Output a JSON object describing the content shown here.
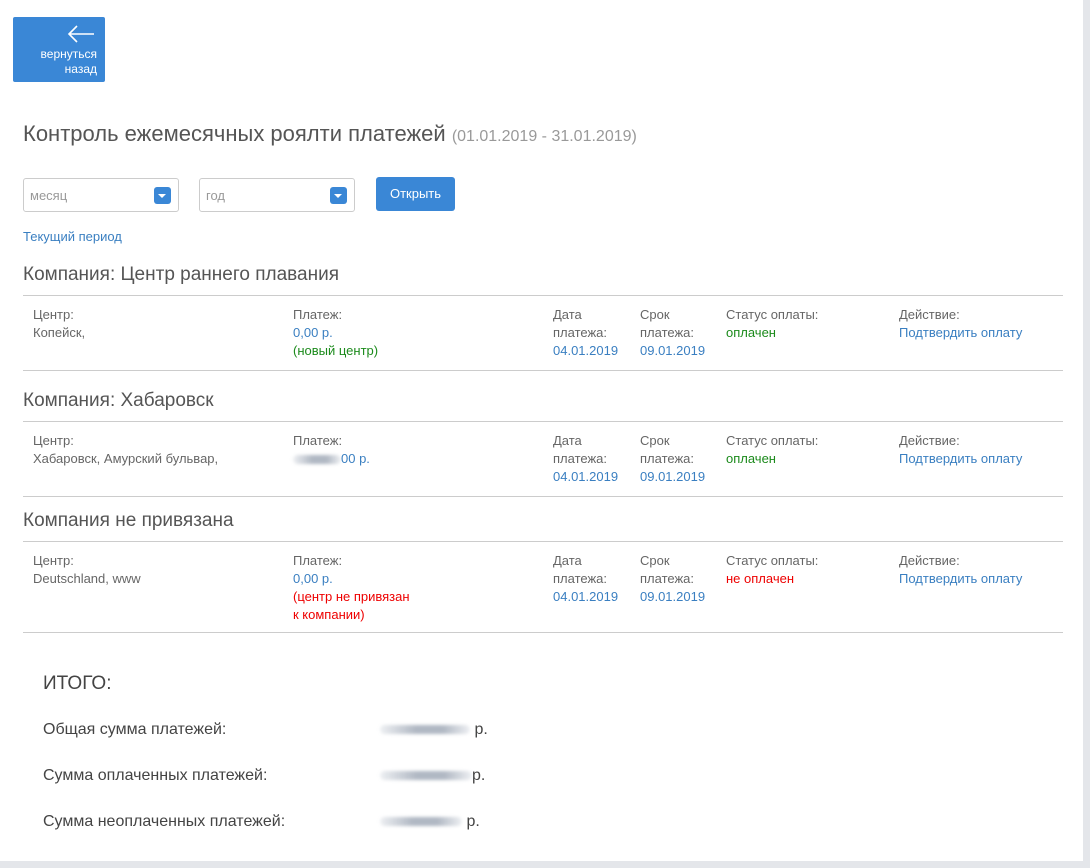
{
  "header": {
    "back_label_line1": "вернуться",
    "back_label_line2": "назад",
    "title": "Контроль ежемесячных роялти платежей",
    "period": "(01.01.2019 - 31.01.2019)"
  },
  "filters": {
    "month_placeholder": "месяц",
    "year_placeholder": "год",
    "open_label": "Открыть",
    "current_period_label": "Текущий период"
  },
  "labels": {
    "center": "Центр:",
    "payment": "Платеж:",
    "date_line1": "Дата",
    "date_line2": "платежа:",
    "due_line1": "Срок",
    "due_line2": "платежа:",
    "status": "Статус оплаты:",
    "action": "Действие:"
  },
  "companies": [
    {
      "title": "Компания: Центр раннего плавания",
      "center": "Копейск,",
      "payment": "0,00 р.",
      "payment_note": "(новый центр)",
      "date": "04.01.2019",
      "due": "09.01.2019",
      "status": "оплачен",
      "action": "Подтвердить оплату"
    },
    {
      "title": "Компания: Хабаровск",
      "center": "Хабаровск, Амурский бульвар,",
      "payment": "00 р.",
      "date": "04.01.2019",
      "due": "09.01.2019",
      "status": "оплачен",
      "action": "Подтвердить оплату"
    },
    {
      "title": "Компания не привязана",
      "center": "Deutschland, www",
      "payment": "0,00 р.",
      "payment_note_line1": "(центр не привязан",
      "payment_note_line2": "к компании)",
      "date": "04.01.2019",
      "due": "09.01.2019",
      "status": "не оплачен",
      "action": "Подтвердить оплату"
    }
  ],
  "totals": {
    "title": "ИТОГО:",
    "total_label": "Общая сумма платежей:",
    "paid_label": "Сумма оплаченных платежей:",
    "unpaid_label": "Сумма неоплаченных платежей:",
    "currency": "р."
  },
  "colors": {
    "accent": "#3a87d6",
    "link": "#3a7fc1",
    "paid": "#1b8a1b",
    "unpaid": "#ee0000"
  },
  "icons": {
    "back": "arrow-left-icon",
    "select_caret": "chevron-down-icon"
  }
}
